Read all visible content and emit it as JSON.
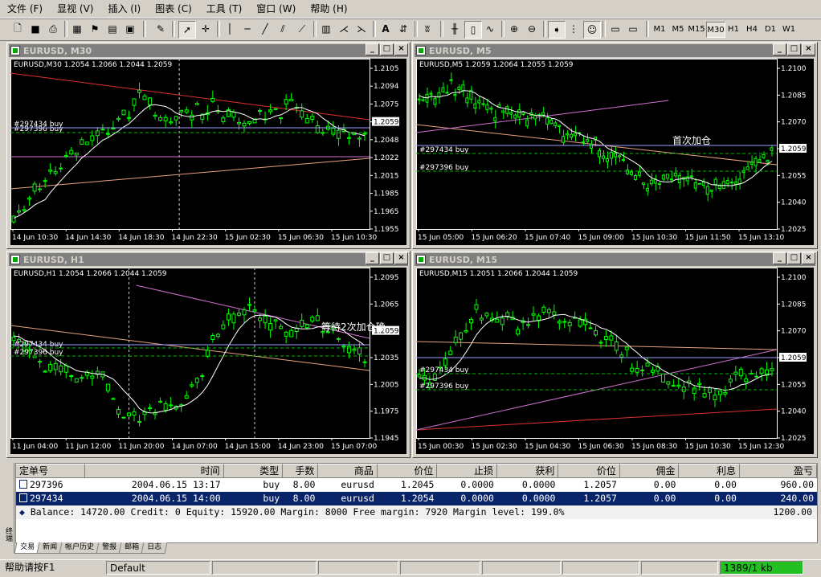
{
  "menu": [
    "文件 (F)",
    "显视 (V)",
    "插入 (I)",
    "图表 (C)",
    "工具 (T)",
    "窗口 (W)",
    "帮助 (H)"
  ],
  "timeframes": [
    "M1",
    "M5",
    "M15",
    "M30",
    "H1",
    "H4",
    "D1",
    "W1"
  ],
  "active_timeframe": "M30",
  "charts": [
    {
      "title": "EURUSD, M30",
      "header": "EURUSD,M30  1.2054 1.2066 1.2044 1.2059",
      "price_labels": [
        "1.2105",
        "1.2094",
        "1.2075",
        "1.2059",
        "1.2048",
        "1.2022",
        "1.2015",
        "1.1985",
        "1.1965",
        "1.1955"
      ],
      "time_labels": [
        "14 Jun 10:30",
        "14 Jun 14:30",
        "14 Jun 18:30",
        "14 Jun 22:30",
        "15 Jun 02:30",
        "15 Jun 06:30",
        "15 Jun 10:30"
      ],
      "order_lines": [
        "#297434 buy",
        "#297396 buy"
      ],
      "current_price": "1.2059",
      "annotation": ""
    },
    {
      "title": "EURUSD, M5",
      "header": "EURUSD,M5  1.2059 1.2064 1.2055 1.2059",
      "price_labels": [
        "1.2100",
        "1.2085",
        "1.2070",
        "1.2059",
        "1.2055",
        "1.2040",
        "1.2025"
      ],
      "time_labels": [
        "15 Jun 05:00",
        "15 Jun 06:20",
        "15 Jun 07:40",
        "15 Jun 09:00",
        "15 Jun 10:30",
        "15 Jun 11:50",
        "15 Jun 13:10"
      ],
      "order_lines": [
        "#297434 buy",
        "#297396 buy"
      ],
      "current_price": "1.2059",
      "annotation": "首次加仓"
    },
    {
      "title": "EURUSD, H1",
      "header": "EURUSD,H1  1.2054 1.2066 1.2044 1.2059",
      "price_labels": [
        "1.2095",
        "1.2065",
        "1.2059",
        "1.2035",
        "1.2005",
        "1.1975",
        "1.1945"
      ],
      "time_labels": [
        "11 Jun 04:00",
        "11 Jun 12:00",
        "11 Jun 20:00",
        "14 Jun 07:00",
        "14 Jun 15:00",
        "14 Jun 23:00",
        "15 Jun 07:00"
      ],
      "order_lines": [
        "#297434 buy",
        "#297396 buy"
      ],
      "current_price": "1.2059",
      "annotation": "等待2次加仓确"
    },
    {
      "title": "EURUSD, M15",
      "header": "EURUSD,M15  1.2051 1.2066 1.2044 1.2059",
      "price_labels": [
        "1.2100",
        "1.2085",
        "1.2070",
        "1.2059",
        "1.2055",
        "1.2040",
        "1.2025"
      ],
      "time_labels": [
        "15 Jun 00:30",
        "15 Jun 02:30",
        "15 Jun 04:30",
        "15 Jun 06:30",
        "15 Jun 08:30",
        "15 Jun 10:30",
        "15 Jun 12:30"
      ],
      "order_lines": [
        "#297434 buy",
        "#297396 buy"
      ],
      "current_price": "1.2059",
      "annotation": ""
    }
  ],
  "terminal": {
    "columns": [
      "定单号",
      "时间",
      "类型",
      "手数",
      "商品",
      "价位",
      "止损",
      "获利",
      "价位",
      "佣金",
      "利息",
      "盈亏"
    ],
    "rows": [
      [
        "297396",
        "2004.06.15 13:17",
        "buy",
        "8.00",
        "eurusd",
        "1.2045",
        "0.0000",
        "0.0000",
        "1.2057",
        "0.00",
        "0.00",
        "960.00"
      ],
      [
        "297434",
        "2004.06.15 14:00",
        "buy",
        "8.00",
        "eurusd",
        "1.2054",
        "0.0000",
        "0.0000",
        "1.2057",
        "0.00",
        "0.00",
        "240.00"
      ]
    ],
    "balance_line": "Balance: 14720.00  Credit: 0  Equity: 15920.00  Margin: 8000 Free margin: 7920 Margin level: 199.0%",
    "balance_total": "1200.00",
    "tabs": [
      "交易",
      "新闻",
      "帐户历史",
      "警报",
      "邮箱",
      "日志"
    ],
    "side_label": "终端"
  },
  "status": {
    "help": "帮助请按F1",
    "profile": "Default",
    "traffic": "1389/1 kb"
  }
}
